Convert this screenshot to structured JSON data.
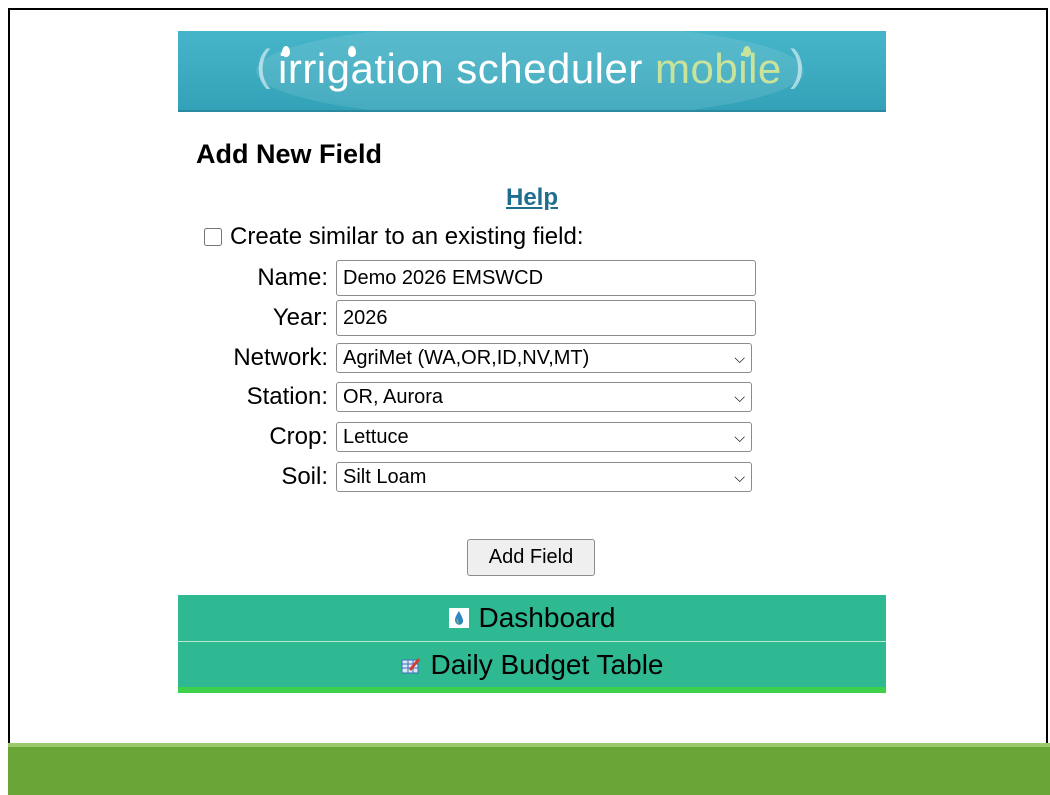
{
  "banner": {
    "word1": "irrigation",
    "word2": "scheduler",
    "word3": "mobile"
  },
  "page": {
    "title": "Add New Field",
    "help_link": "Help",
    "similar_label": "Create similar to an existing field:"
  },
  "form": {
    "name": {
      "label": "Name:",
      "value": "Demo 2026 EMSWCD"
    },
    "year": {
      "label": "Year:",
      "value": "2026"
    },
    "network": {
      "label": "Network:",
      "selected": "AgriMet (WA,OR,ID,NV,MT)"
    },
    "station": {
      "label": "Station:",
      "selected": "OR, Aurora"
    },
    "crop": {
      "label": "Crop:",
      "selected": "Lettuce"
    },
    "soil": {
      "label": "Soil:",
      "selected": "Silt Loam"
    },
    "submit_label": "Add Field"
  },
  "nav": {
    "dashboard": {
      "label": "Dashboard",
      "icon": "water-drop-icon"
    },
    "daily_budget": {
      "label": "Daily Budget Table",
      "icon": "table-edit-icon"
    }
  },
  "colors": {
    "banner": "#33a2b8",
    "nav": "#2fb993",
    "link": "#1f6e8f",
    "footer_band": "#6aa538"
  }
}
